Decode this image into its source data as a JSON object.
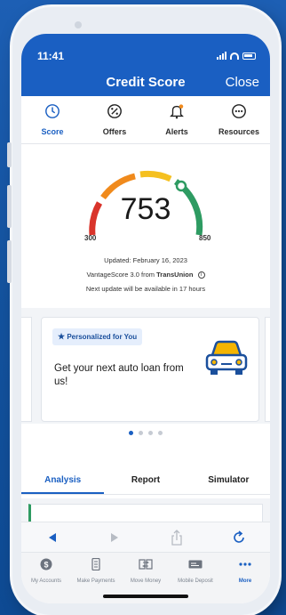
{
  "status": {
    "time": "11:41"
  },
  "header": {
    "title": "Credit Score",
    "close_label": "Close"
  },
  "nav": {
    "items": [
      {
        "label": "Score",
        "icon": "score-icon",
        "active": true
      },
      {
        "label": "Offers",
        "icon": "percent-icon",
        "active": false
      },
      {
        "label": "Alerts",
        "icon": "bell-icon",
        "active": false
      },
      {
        "label": "Resources",
        "icon": "ellipsis-circle-icon",
        "active": false
      }
    ]
  },
  "score": {
    "value": "753",
    "min": "300",
    "max": "850",
    "updated": "Updated: February 16, 2023",
    "model_prefix": "VantageScore 3.0 from ",
    "model_source": "TransUnion",
    "next_update": "Next update will be available in 17 hours"
  },
  "promo": {
    "badge": "Personalized for You",
    "text": "Get your next auto loan from us!",
    "page_index": 1,
    "page_count": 4
  },
  "subtabs": [
    {
      "label": "Analysis",
      "active": true
    },
    {
      "label": "Report",
      "active": false
    },
    {
      "label": "Simulator",
      "active": false
    }
  ],
  "bottom_nav": [
    {
      "label": "My Accounts",
      "icon": "dollar-circle-icon",
      "active": false
    },
    {
      "label": "Make Payments",
      "icon": "document-icon",
      "active": false
    },
    {
      "label": "Move Money",
      "icon": "transfer-icon",
      "active": false
    },
    {
      "label": "Mobile Deposit",
      "icon": "check-deposit-icon",
      "active": false
    },
    {
      "label": "More",
      "icon": "more-dots-icon",
      "active": true
    }
  ],
  "colors": {
    "brand_blue": "#1a5fc2",
    "gauge_red": "#d9342b",
    "gauge_orange": "#f08a1c",
    "gauge_yellow": "#f5c020",
    "gauge_green": "#2e9b62",
    "car_yellow": "#f4b400"
  }
}
